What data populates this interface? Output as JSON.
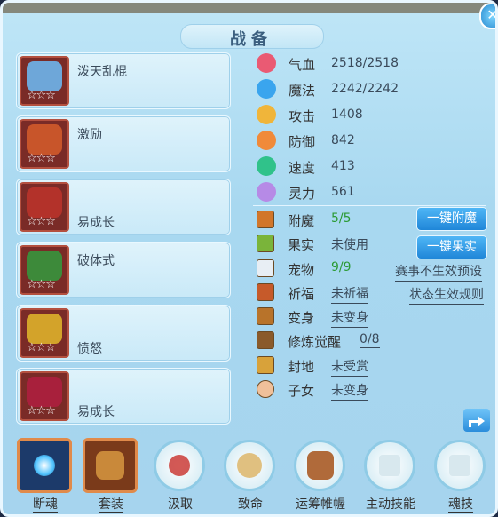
{
  "window": {
    "title": "战备",
    "close_label": "✕"
  },
  "equipment": [
    {
      "name": "泼天乱棍",
      "stars": "☆☆☆",
      "art_color": "#6ea7d9"
    },
    {
      "name": "激励",
      "stars": "☆☆☆",
      "art_color": "#c8552a"
    },
    {
      "name": "易成长",
      "stars": "☆☆☆",
      "art_color": "#b3322a"
    },
    {
      "name": "破体式",
      "stars": "☆☆☆",
      "art_color": "#3d8a3a"
    },
    {
      "name": "愤怒",
      "stars": "☆☆☆",
      "art_color": "#d3a32a"
    },
    {
      "name": "易成长",
      "stars": "☆☆☆",
      "art_color": "#a8203c"
    }
  ],
  "stats": [
    {
      "label": "气血",
      "value": "2518/2518",
      "color": "#ea5a73"
    },
    {
      "label": "魔法",
      "value": "2242/2242",
      "color": "#3aa5ee"
    },
    {
      "label": "攻击",
      "value": "1408",
      "color": "#f0b53a"
    },
    {
      "label": "防御",
      "value": "842",
      "color": "#f08a3a"
    },
    {
      "label": "速度",
      "value": "413",
      "color": "#30c28a"
    },
    {
      "label": "灵力",
      "value": "561",
      "color": "#b68ae6"
    }
  ],
  "rows": [
    {
      "label": "附魔",
      "value": "5/5",
      "icon_color": "#d1762a"
    },
    {
      "label": "果实",
      "value": "未使用",
      "icon_color": "#7ab43a"
    },
    {
      "label": "宠物",
      "value": "9/9",
      "icon_color": "#e8eef4"
    },
    {
      "label": "祈福",
      "value": "未祈福",
      "icon_color": "#c65a2a"
    },
    {
      "label": "变身",
      "value": "未变身",
      "icon_color": "#b8732a"
    },
    {
      "label": "修炼觉醒",
      "value": "0/8",
      "icon_color": "#8a5a2a"
    },
    {
      "label": "封地",
      "value": "未受赏",
      "icon_color": "#d8a23a"
    },
    {
      "label": "子女",
      "value": "未变身",
      "icon_color": "#f0c09a"
    }
  ],
  "buttons": {
    "enchant": "一键附魔",
    "fruit": "一键果实"
  },
  "links": {
    "competition": "赛事不生效预设",
    "status_rule": "状态生效规则"
  },
  "skills": [
    {
      "label": "断魂"
    },
    {
      "label": "套装"
    },
    {
      "label": "汲取"
    },
    {
      "label": "致命"
    },
    {
      "label": "运筹帷幄"
    },
    {
      "label": "主动技能"
    },
    {
      "label": "魂技"
    }
  ]
}
